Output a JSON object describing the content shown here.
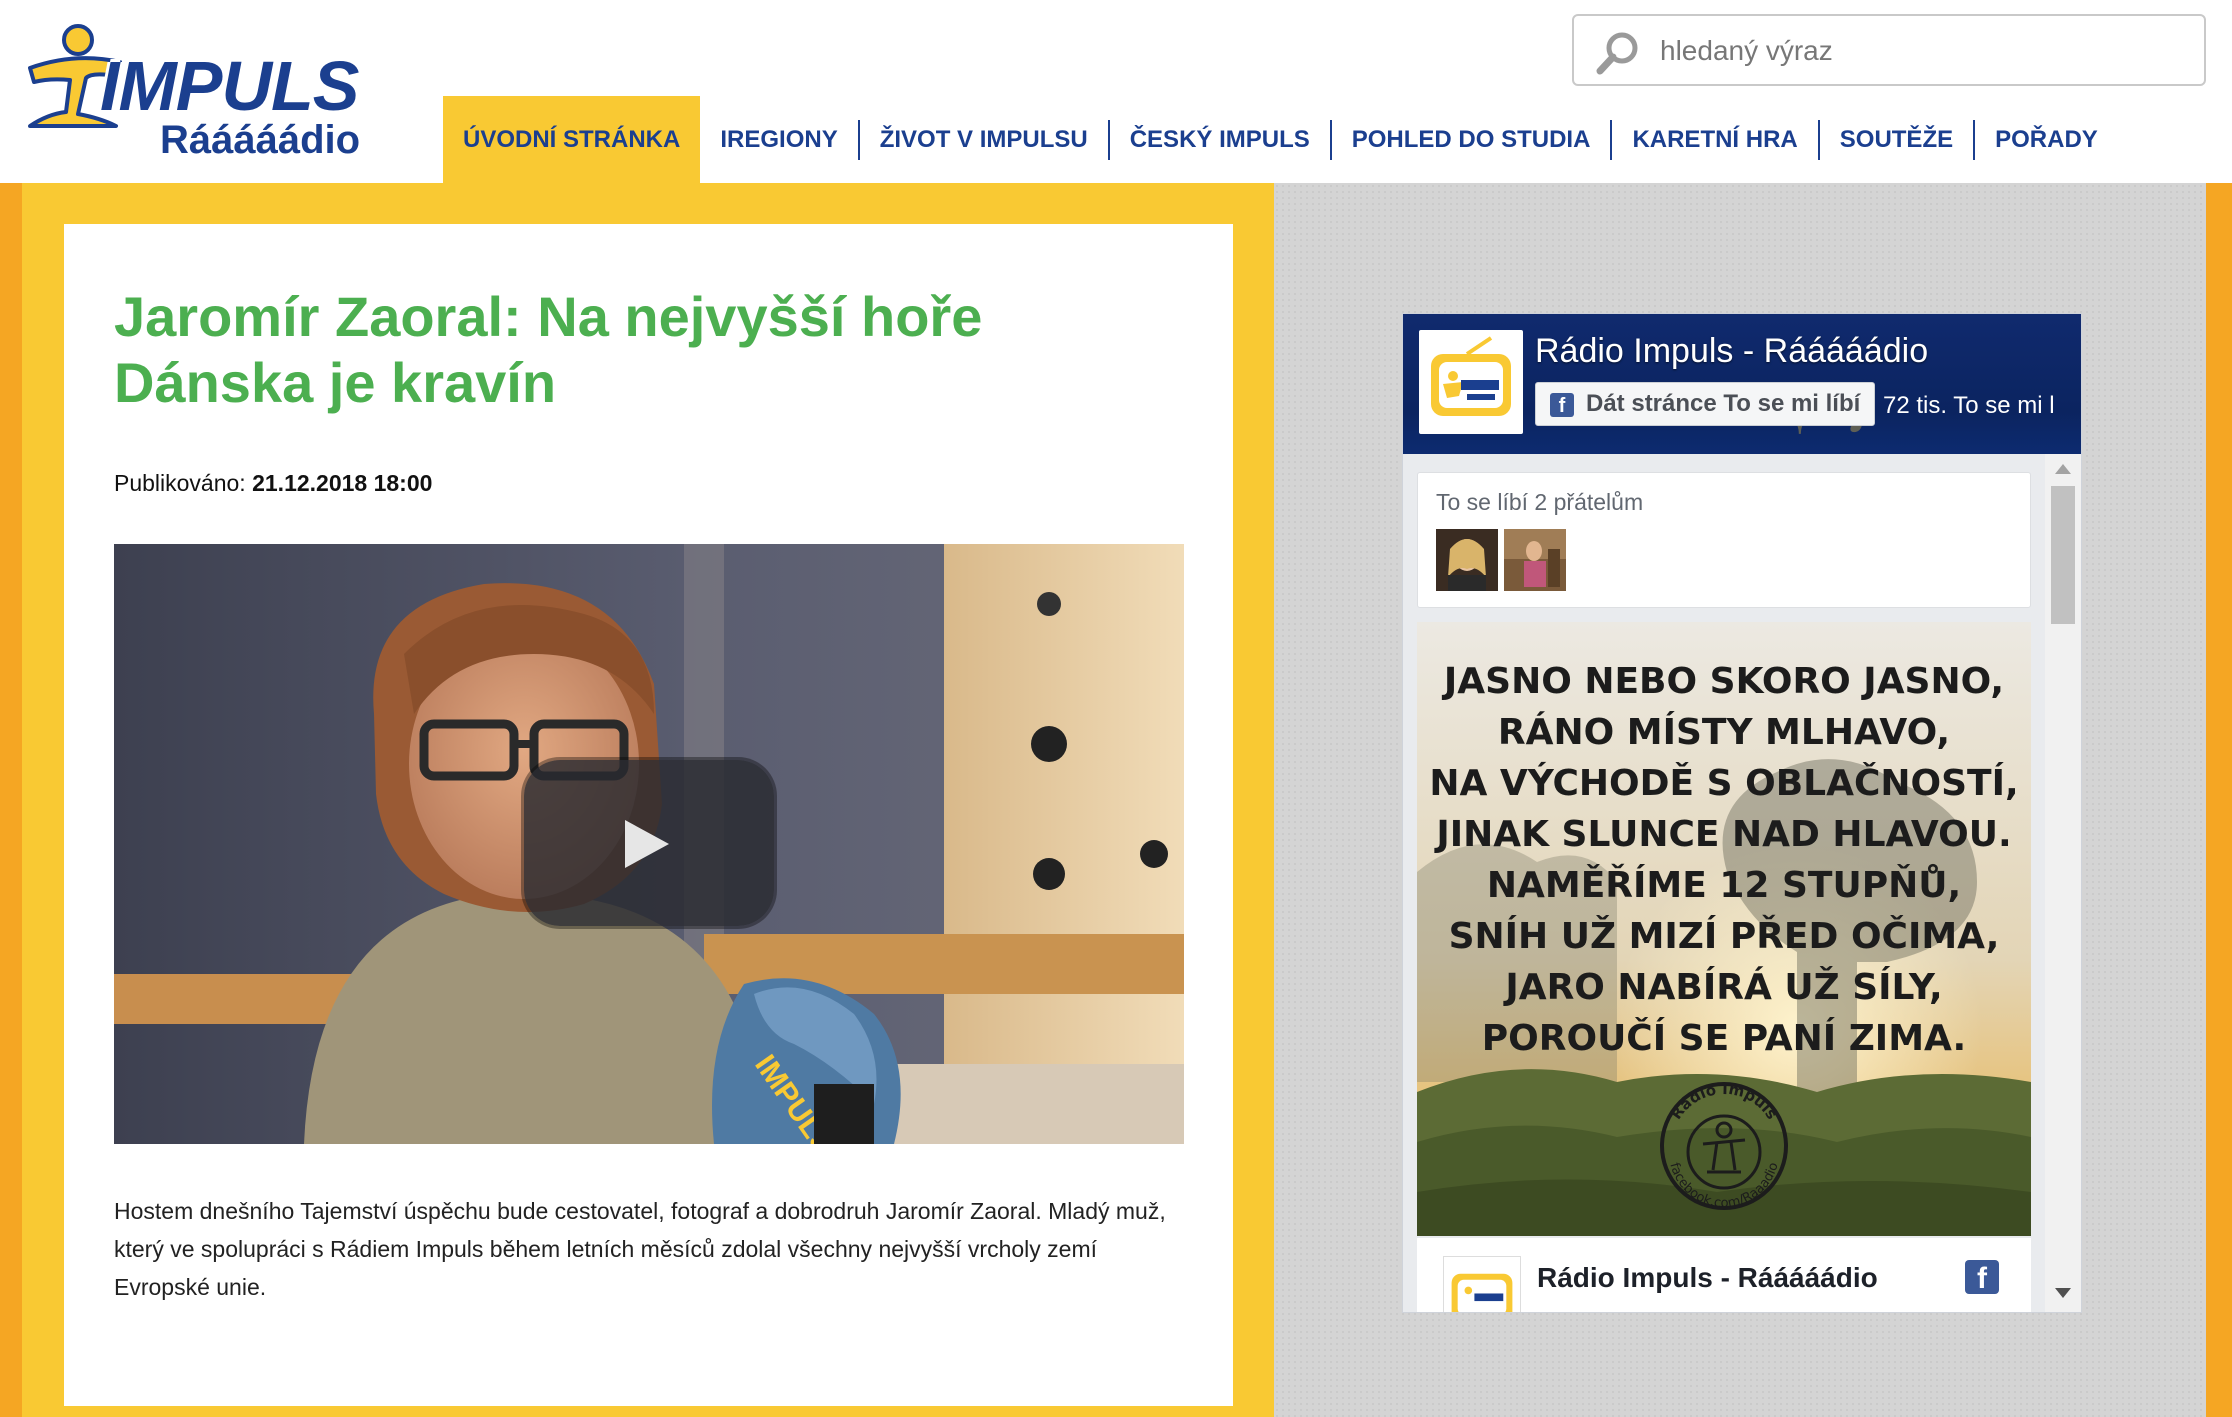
{
  "header": {
    "logo_word": "IMPULS",
    "logo_sub": "Rááááádio",
    "search": {
      "placeholder": "hledaný výraz",
      "value": ""
    },
    "nav": [
      {
        "label": "ÚVODNÍ STRÁNKA",
        "active": true
      },
      {
        "label": "IREGIONY"
      },
      {
        "label": "ŽIVOT V IMPULSU"
      },
      {
        "label": "ČESKÝ IMPULS"
      },
      {
        "label": "POHLED DO STUDIA"
      },
      {
        "label": "KARETNÍ HRA"
      },
      {
        "label": "SOUTĚŽE"
      },
      {
        "label": "POŘADY"
      }
    ]
  },
  "article": {
    "title": "Jaromír Zaoral: Na nejvyšší hoře Dánska je kravín",
    "published_label": "Publikováno:",
    "published_date": "21.12.2018 18:00",
    "body": "Hostem dnešního Tajemství úspěchu bude cestovatel, fotograf a dobrodruh Jaromír Zaoral. Mladý muž, který ve spolupráci s Rádiem Impuls během letních měsíců zdolal všechny nejvyšší vrcholy zemí Evropské unie.",
    "video": {
      "mic_brand": "IMPULS"
    }
  },
  "facebook": {
    "page_name": "Rádio Impuls - Rááááádio",
    "like_button": "Dát stránce To se mi líbí",
    "like_count": "72 tis. To se mi l",
    "friends_text": "To se líbí 2 přátelům",
    "post": {
      "weather_lines": [
        "JASNO NEBO SKORO JASNO,",
        "RÁNO MÍSTY MLHAVO,",
        "NA VÝCHODĚ S OBLAČNOSTÍ,",
        "JINAK SLUNCE NAD HLAVOU.",
        "NAMĚŘÍME 12 STUPŇŮ,",
        "SNÍH UŽ MIZÍ PŘED OČIMA,",
        "JARO NABÍRÁ UŽ SÍLY,",
        "POROUČÍ SE PANÍ ZIMA."
      ],
      "stamp_top": "Rádio Impuls",
      "stamp_bottom": "facebook.com/Raaadio",
      "author": "Rádio Impuls - Rááááádio"
    }
  },
  "colors": {
    "brand_blue": "#1b3f8f",
    "brand_yellow": "#f9c933",
    "title_green": "#4caf50",
    "facebook_blue": "#3b5998"
  },
  "icons": [
    "impuls-logo-icon",
    "search-icon",
    "play-icon",
    "facebook-icon",
    "scroll-up-icon",
    "scroll-down-icon"
  ]
}
